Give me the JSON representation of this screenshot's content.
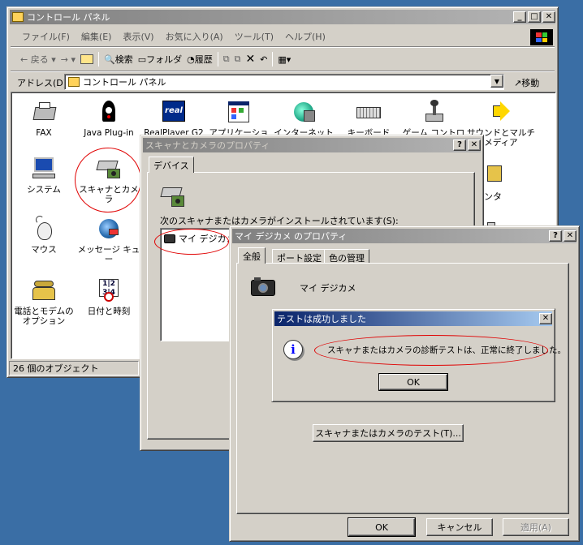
{
  "control_panel": {
    "title": "コントロール パネル",
    "menu": [
      "ファイル(F)",
      "編集(E)",
      "表示(V)",
      "お気に入り(A)",
      "ツール(T)",
      "ヘルプ(H)"
    ],
    "toolbar": {
      "back": "戻る",
      "search": "検索",
      "folders": "フォルダ",
      "history": "履歴"
    },
    "address_label": "アドレス(D)",
    "address_value": "コントロール パネル",
    "go_label": "移動",
    "items": [
      {
        "label": "FAX",
        "icon": "fax-icon"
      },
      {
        "label": "Java Plug-in",
        "icon": "java-icon"
      },
      {
        "label": "RealPlayer G2",
        "icon": "realplayer-icon"
      },
      {
        "label": "アプリケーション",
        "icon": "applications-icon"
      },
      {
        "label": "インターネット オ",
        "icon": "internet-options-icon"
      },
      {
        "label": "キーボード",
        "icon": "keyboard-icon"
      },
      {
        "label": "ゲーム コントロ",
        "icon": "game-controller-icon"
      },
      {
        "label": "サウンドとマルチメディア",
        "icon": "sound-icon"
      },
      {
        "label": "システム",
        "icon": "system-icon"
      },
      {
        "label": "スキャナとカメラ",
        "icon": "scanner-camera-icon"
      },
      {
        "label": "マウス",
        "icon": "mouse-icon"
      },
      {
        "label": "メッセージ キュー",
        "icon": "message-queue-icon"
      },
      {
        "label": "電話とモデムのオプション",
        "icon": "phone-modem-icon"
      },
      {
        "label": "日付と時刻",
        "icon": "date-time-icon"
      }
    ],
    "partial_right": [
      "ンタ"
    ],
    "status": "26 個のオブジェクト"
  },
  "scanner_props": {
    "title": "スキャナとカメラのプロパティ",
    "tab": "デバイス",
    "installed_text": "次のスキャナまたはカメラがインストールされています(S):",
    "device": "マイ デジカメ"
  },
  "camera_props": {
    "title": "マイ デジカメ のプロパティ",
    "tabs": [
      "全般",
      "ポート設定",
      "色の管理"
    ],
    "device_name": "マイ デジカメ",
    "test_button": "スキャナまたはカメラのテスト(T)...",
    "ok": "OK",
    "cancel": "キャンセル",
    "apply": "適用(A)"
  },
  "test_dialog": {
    "title": "テストは成功しました",
    "message": "スキャナまたはカメラの診断テストは、正常に終了しました。",
    "ok": "OK"
  },
  "colors": {
    "highlight_red": "#e00000",
    "title_active": "#0a246a",
    "desktop": "#3a6ea5"
  }
}
